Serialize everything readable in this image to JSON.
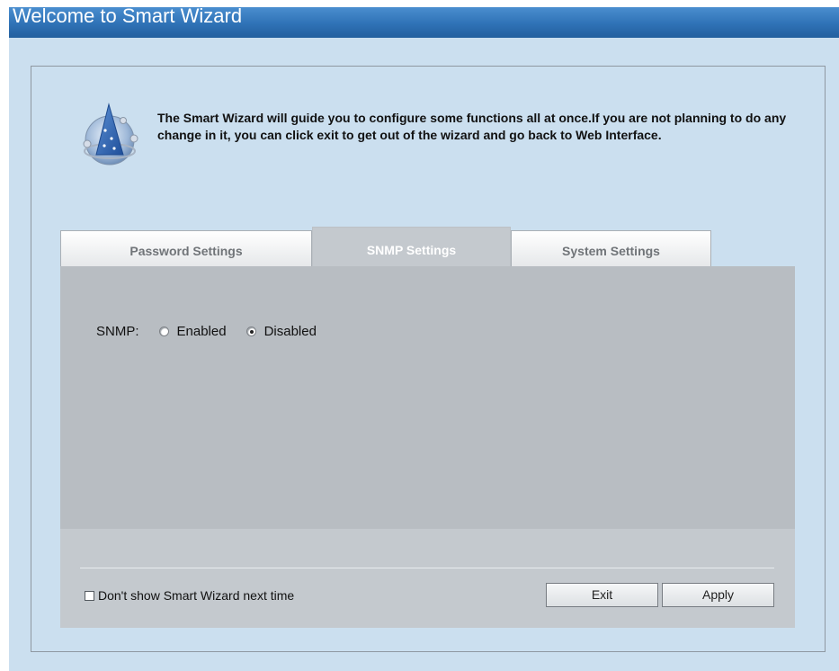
{
  "window": {
    "title": "Welcome to Smart Wizard"
  },
  "intro": {
    "icon": "wizard-hat-icon",
    "text": "The Smart Wizard will guide you to configure some functions all at once.If you are not planning to do any change in it, you can click exit to get out of the wizard and go back to Web Interface."
  },
  "tabs": [
    {
      "label": "Password Settings",
      "active": false
    },
    {
      "label": "SNMP Settings",
      "active": true
    },
    {
      "label": "System Settings",
      "active": false
    }
  ],
  "snmp": {
    "label": "SNMP:",
    "options": [
      {
        "label": "Enabled",
        "checked": false
      },
      {
        "label": "Disabled",
        "checked": true
      }
    ]
  },
  "footer": {
    "dont_show_label": "Don't show Smart Wizard next time",
    "dont_show_checked": false,
    "exit_label": "Exit",
    "apply_label": "Apply"
  },
  "colors": {
    "title_bar": "#2f72b6",
    "content_background": "#cbdfef",
    "panel": "#c4c9ce",
    "active_tab_text": "#ffffff"
  }
}
